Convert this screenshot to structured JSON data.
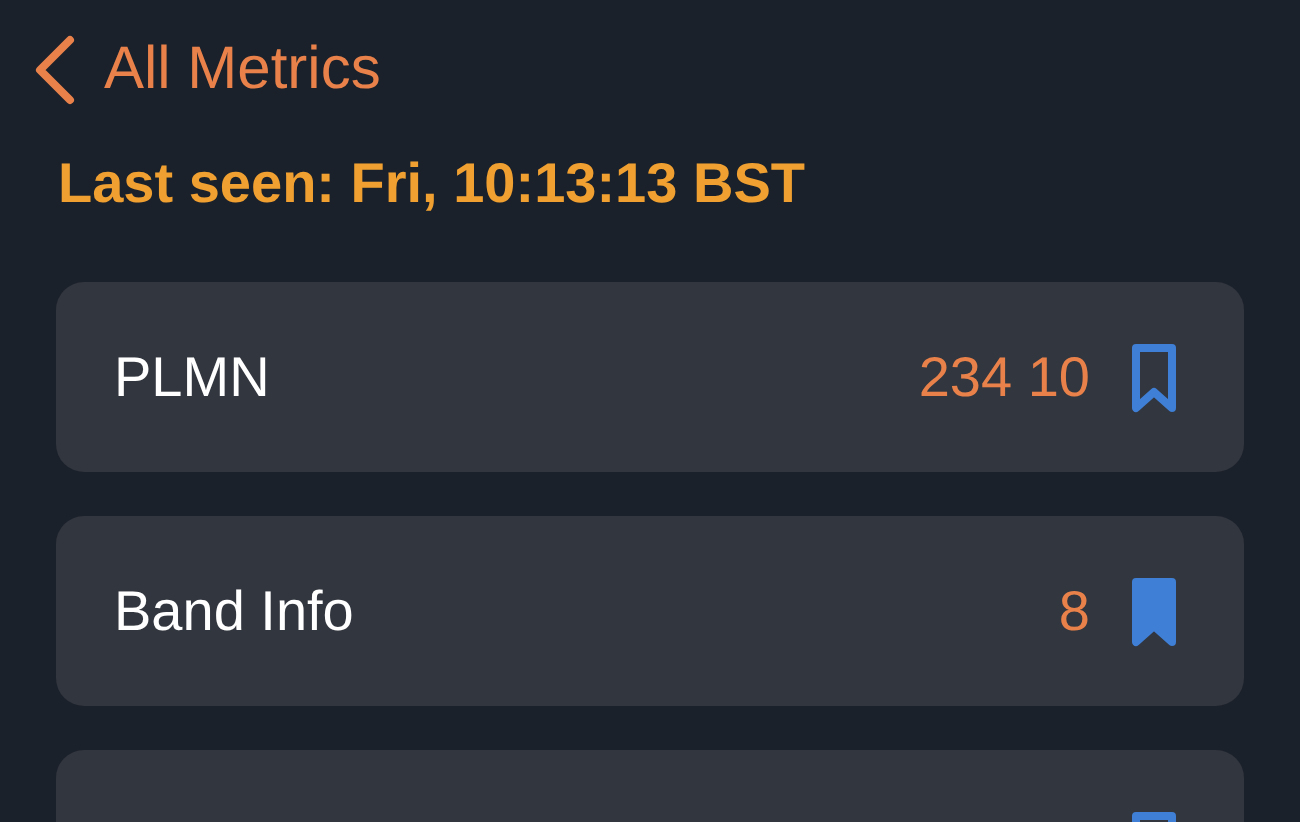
{
  "back_link": {
    "label": "All Metrics"
  },
  "last_seen": "Last seen: Fri, 10:13:13 BST",
  "metrics": [
    {
      "label": "PLMN",
      "value": "234 10",
      "bookmarked": false
    },
    {
      "label": "Band Info",
      "value": "8",
      "bookmarked": true
    },
    {
      "bookmarked": false
    }
  ]
}
